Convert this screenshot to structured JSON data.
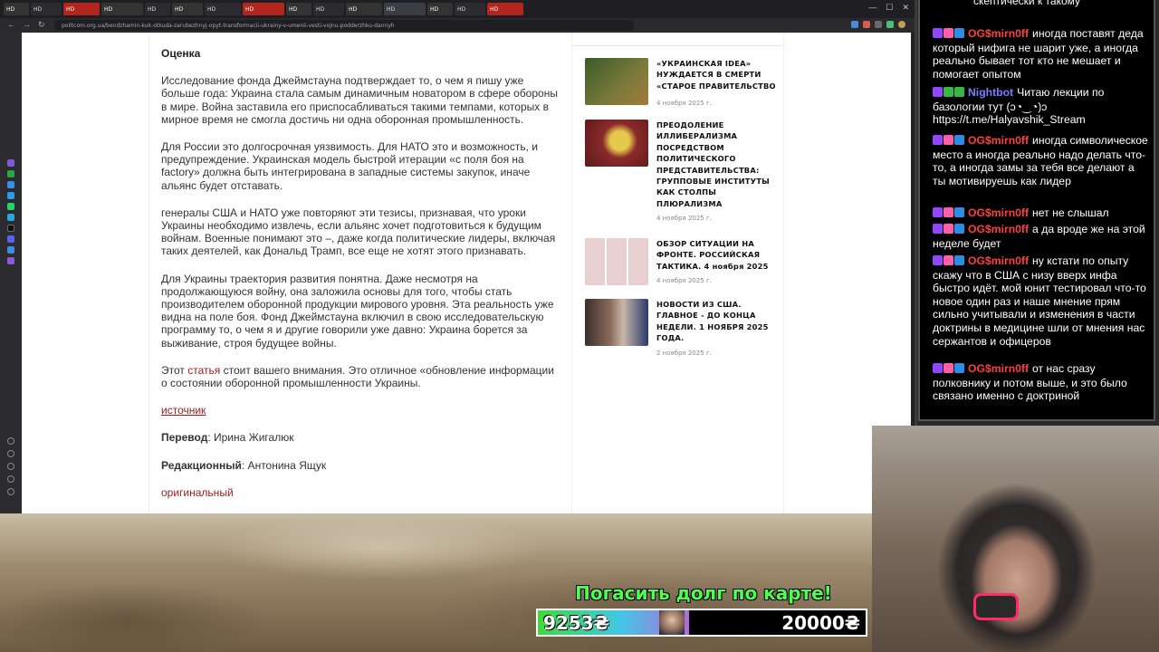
{
  "browser": {
    "tabs": [
      "HD",
      "HD",
      "HD",
      "HD",
      "HD",
      "HD",
      "HD",
      "HD",
      "HD",
      "HD",
      "HD",
      "HD",
      "HD",
      "HD",
      "HD"
    ],
    "url": "politcom.org.ua/bendzhamin-kuk-otkuda-zarubezhnyj-opyt-transformacii-ukrainy-v-umenii-vesti-vojnu-podderzhku-dannyh"
  },
  "article": {
    "heading": "Оценка",
    "paragraphs": [
      "Исследование фонда Джеймстауна подтверждает то, о чем я пишу уже больше года: Украина стала самым динамичным новатором в сфере обороны в мире. Война заставила его приспосабливаться такими темпами, которых в мирное время не смогла достичь ни одна оборонная промышленность.",
      "Для России это долгосрочная уязвимость. Для НАТО это и возможность, и предупреждение. Украинская модель быстрой итерации «с поля боя на factory» должна быть интегрирована в западные системы закупок, иначе альянс будет отставать.",
      "генералы США и НАТО уже повторяют эти тезисы, признавая, что уроки Украины необходимо извлечь, если альянс хочет подготовиться к будущим войнам. Военные понимают это –, даже когда политические лидеры, включая таких деятелей, как Дональд Трамп, все еще не хотят этого признавать.",
      "Для Украины траектория развития понятна. Даже несмотря на продолжающуюся войну, она заложила основы для того, чтобы стать производителем оборонной продукции мирового уровня. Эта реальность уже видна на поле боя. Фонд Джеймстауна включил в свою исследовательскую программу то, о чем я и другие говорили уже давно: Украина борется за выживание, строя будущее войны."
    ],
    "last_para_pre": "Этот ",
    "last_para_link": "статья",
    "last_para_post": " стоит вашего внимания. Это отличное «обновление информации о состоянии оборонной промышленности Украины.",
    "source_link": "источник",
    "translation_label": "Перевод",
    "translation_value": ": Ирина Жигалюк",
    "editor_label": "Редакционный",
    "editor_value": ": Антонина Ящук",
    "original_link": "оригинальный"
  },
  "sidebar_news": [
    {
      "title": "«УКРАИНСКАЯ IDEA» НУЖДАЕТСЯ В СМЕРТИ «СТАРОЕ ПРАВИТЕЛЬСТВО",
      "date": "4 ноября 2025 г.",
      "thumb_color": "#6b6a3a"
    },
    {
      "title": "ПРЕОДОЛЕНИЕ ИЛЛИБЕРАЛИЗМА ПОСРЕДСТВОМ ПОЛИТИЧЕСКОГО ПРЕДСТАВИТЕЛЬСТВА: ГРУППОВЫЕ ИНСТИТУТЫ КАК СТОЛПЫ ПЛЮРАЛИЗМА",
      "date": "4 ноября 2025 г.",
      "thumb_color": "#9a2d2d"
    },
    {
      "title": "ОБЗОР СИТУАЦИИ НА ФРОНТЕ. РОССИЙСКАЯ ТАКТИКА. 4 ноября 2025",
      "date": "4 ноября 2025 г.",
      "thumb_color": "#b45a5a"
    },
    {
      "title": "НОВОСТИ ИЗ США. ГЛАВНОЕ - ДО КОНЦА НЕДЕЛИ. 1 НОЯБРЯ 2025 ГОДА.",
      "date": "2 ноября 2025 г.",
      "thumb_color": "#5b4a44"
    }
  ],
  "chat": {
    "partial_top": "скептически к такому",
    "messages": [
      {
        "user": "OG$mirn0ff",
        "color": "#ff3e3e",
        "text": "иногда поставят деда который нифига не шарит уже, а иногда реально бывает тот кто не мешает и помогает опытом"
      },
      {
        "user": "Nightbot",
        "color": "#7c7cff",
        "text": "Читаю лекции по базологии тут (ↄ◔‿◔)ↄ https://t.me/Halyavshik_Stream"
      },
      {
        "user": "OG$mirn0ff",
        "color": "#ff3e3e",
        "text": "иногда символическое место а иногда реально надо делать что-то, а иногда замы за тебя все делают а ты мотивируешь как лидер"
      },
      {
        "user": "OG$mirn0ff",
        "color": "#ff3e3e",
        "text": "нет не слышал"
      },
      {
        "user": "OG$mirn0ff",
        "color": "#ff3e3e",
        "text": "а да вроде же на этой неделе будет"
      },
      {
        "user": "OG$mirn0ff",
        "color": "#ff3e3e",
        "text": "ну кстати по опыту скажу что в США с низу вверх инфа быстро идёт. мой юнит тестировал что-то новое один раз и наше мнение прям сильно учитывали и изменения в части доктрины в медицине шли от мнения нас сержантов и офицеров"
      },
      {
        "user": "OG$mirn0ff",
        "color": "#ff3e3e",
        "text": "от нас сразу полковнику и потом выше, и это было связано именно с доктриной"
      }
    ]
  },
  "donation": {
    "title": "Погасить долг по карте!",
    "current": "9253₴",
    "goal": "20000₴",
    "progress_fraction": 0.4627
  }
}
